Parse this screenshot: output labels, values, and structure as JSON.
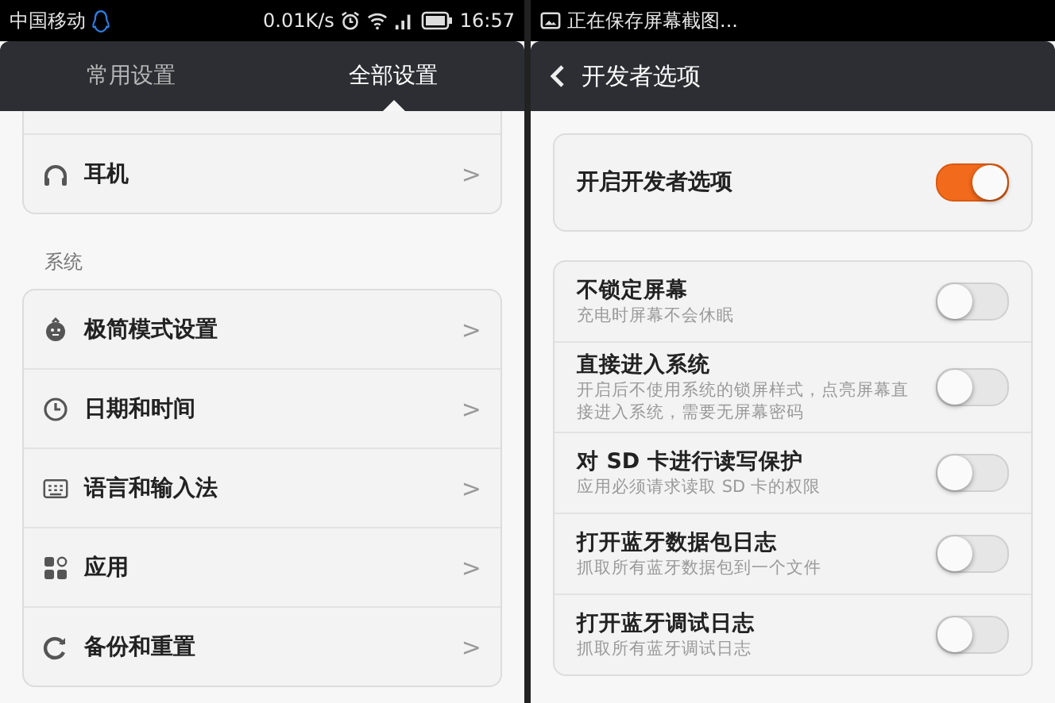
{
  "left": {
    "status_bar": {
      "carrier": "中国移动",
      "speed": "0.01K/s",
      "time": "16:57"
    },
    "tabs": [
      {
        "label": "常用设置",
        "selected": false
      },
      {
        "label": "全部设置",
        "selected": true
      }
    ],
    "top_rows": [
      {
        "label": "耳机",
        "chevron": ">"
      }
    ],
    "section": "系统",
    "system_rows": [
      {
        "label": "极简模式设置",
        "chevron": ">"
      },
      {
        "label": "日期和时间",
        "chevron": ">"
      },
      {
        "label": "语言和输入法",
        "chevron": ">"
      },
      {
        "label": "应用",
        "chevron": ">"
      },
      {
        "label": "备份和重置",
        "chevron": ">"
      }
    ]
  },
  "right": {
    "status_bar": {
      "notice": "正在保存屏幕截图..."
    },
    "title": "开发者选项",
    "master": {
      "label": "开启开发者选项",
      "on": true
    },
    "options": [
      {
        "title": "不锁定屏幕",
        "subtitle": "充电时屏幕不会休眠",
        "on": false
      },
      {
        "title": "直接进入系统",
        "subtitle": "开启后不使用系统的锁屏样式，点亮屏幕直接进入系统，需要无屏幕密码",
        "on": false
      },
      {
        "title": "对 SD 卡进行读写保护",
        "subtitle": "应用必须请求读取 SD 卡的权限",
        "on": false
      },
      {
        "title": "打开蓝牙数据包日志",
        "subtitle": "抓取所有蓝牙数据包到一个文件",
        "on": false
      },
      {
        "title": "打开蓝牙调试日志",
        "subtitle": "抓取所有蓝牙调试日志",
        "on": false
      }
    ]
  }
}
